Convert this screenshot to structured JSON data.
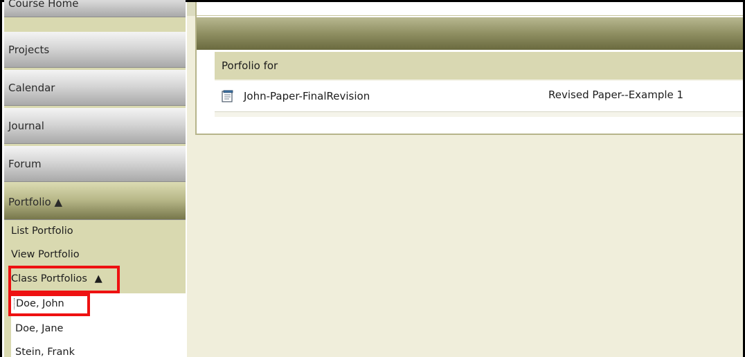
{
  "sidebar": {
    "nav": [
      {
        "label": "Course Home"
      },
      {
        "label": "Projects"
      },
      {
        "label": "Calendar"
      },
      {
        "label": "Journal"
      },
      {
        "label": "Forum"
      },
      {
        "label": "Portfolio ▲"
      }
    ],
    "portfolio_menu": {
      "list_portfolio": "List Portfolio",
      "view_portfolio": "View Portfolio",
      "class_portfolios": "Class Portfolios",
      "class_portfolios_arrow": "▲",
      "students": [
        {
          "name": "Doe, John"
        },
        {
          "name": "Doe, Jane"
        },
        {
          "name": "Stein, Frank"
        }
      ]
    }
  },
  "main": {
    "portfolio_header": "Porfolio for",
    "items": [
      {
        "file_name": "John-Paper-FinalRevision",
        "description": "Revised Paper--Example 1",
        "icon": "document-icon"
      }
    ]
  },
  "colors": {
    "highlight": "#ee1111",
    "sidebar_bg": "#d9d9b0",
    "main_bg": "#f0eedb"
  }
}
